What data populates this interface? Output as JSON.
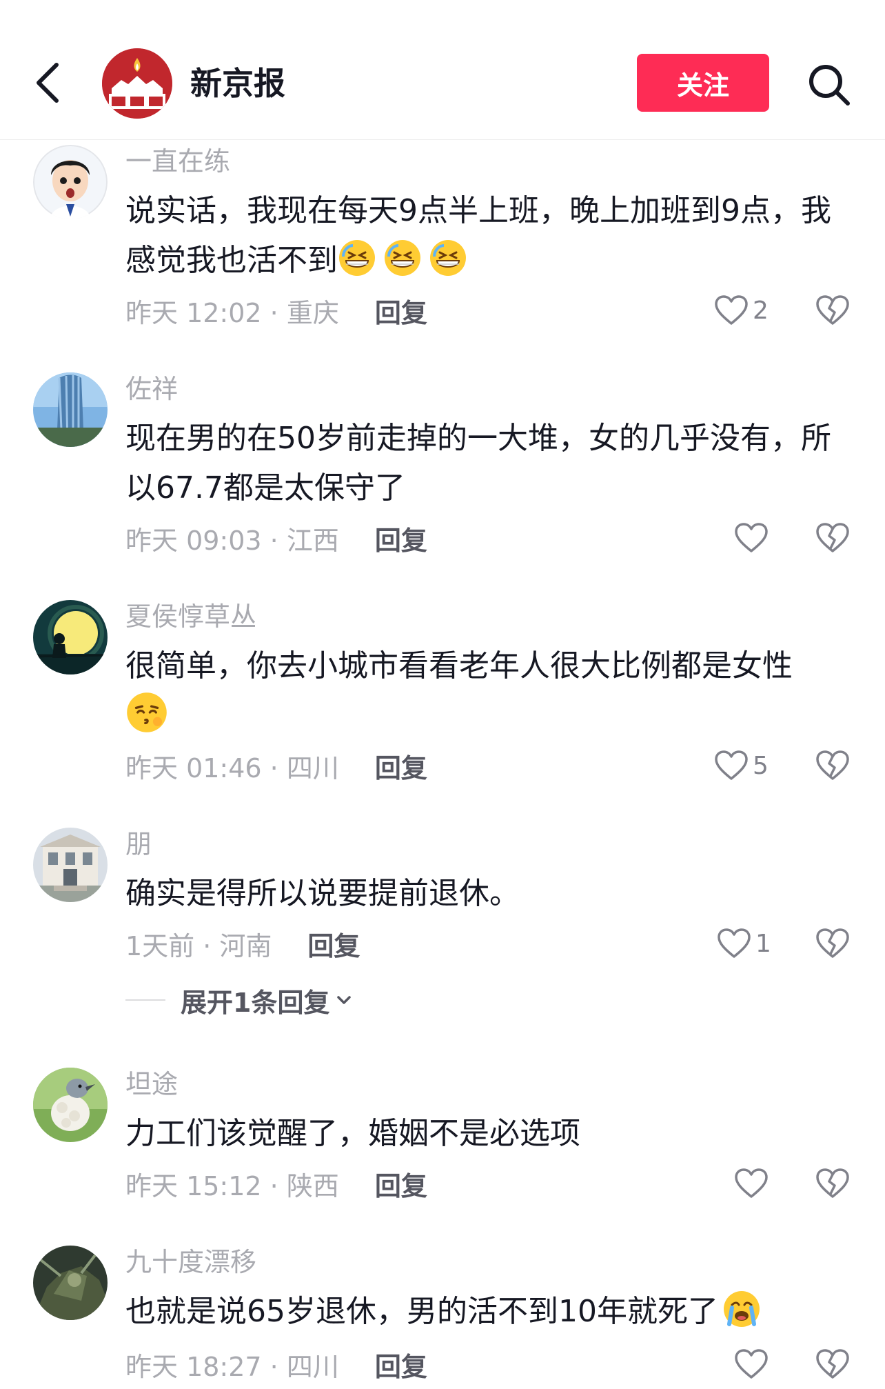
{
  "header": {
    "title": "新京报",
    "follow_label": "关注",
    "logo_text": "新京报"
  },
  "colors": {
    "accent": "#fe2c55",
    "brand_red": "#c1272d",
    "text_primary": "#161823",
    "text_secondary": "#a9aab0"
  },
  "icons": {
    "back": "chevron-left-icon",
    "search": "search-icon",
    "like": "heart-outline-icon",
    "dislike": "broken-heart-icon",
    "expand": "chevron-down-icon"
  },
  "comments": [
    {
      "username": "一直在练",
      "text": "说实话，我现在每天9点半上班，晚上加班到9点，我感觉我也活不到",
      "emojis": [
        "grinning-sweat",
        "grinning-sweat",
        "grinning-sweat"
      ],
      "time_location": "昨天 12:02 · 重庆",
      "reply_label": "回复",
      "likes": "2"
    },
    {
      "username": "佐祥",
      "text": "现在男的在50岁前走掉的一大堆，女的几乎没有，所以67.7都是太保守了",
      "time_location": "昨天 09:03 · 江西",
      "reply_label": "回复",
      "likes": ""
    },
    {
      "username": "夏侯惇草丛",
      "text": "很简单，你去小城市看看老年人很大比例都是女性",
      "emojis": [
        "kissing"
      ],
      "time_location": "昨天 01:46 · 四川",
      "reply_label": "回复",
      "likes": "5"
    },
    {
      "username": "朋",
      "text": "确实是得所以说要提前退休。",
      "time_location": "1天前 · 河南",
      "reply_label": "回复",
      "likes": "1",
      "expand_label": "展开1条回复"
    },
    {
      "username": "坦途",
      "text": "力工们该觉醒了，婚姻不是必选项",
      "time_location": "昨天 15:12 · 陕西",
      "reply_label": "回复",
      "likes": ""
    },
    {
      "username": "九十度漂移",
      "text": "也就是说65岁退休，男的活不到10年就死了",
      "emojis": [
        "crying"
      ],
      "time_location": "昨天 18:27 · 四川",
      "reply_label": "回复",
      "likes": ""
    }
  ]
}
